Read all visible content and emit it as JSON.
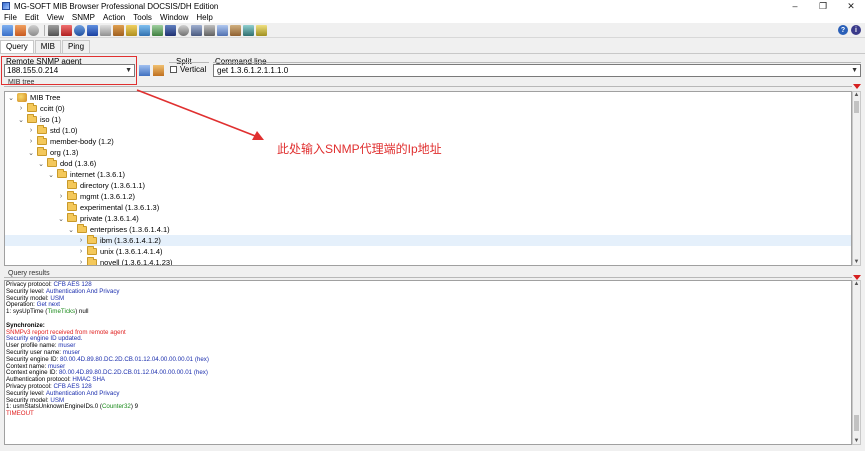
{
  "window": {
    "title": "MG-SOFT MIB Browser Professional DOCSIS/DH Edition"
  },
  "menu": [
    "File",
    "Edit",
    "View",
    "SNMP",
    "Action",
    "Tools",
    "Window",
    "Help"
  ],
  "tabs": [
    "Query",
    "MIB",
    "Ping"
  ],
  "query": {
    "agent_label": "Remote SNMP agent",
    "agent_value": "188.155.0.214",
    "split_label": "Split",
    "vertical_label": "Vertical",
    "command_label": "Command line",
    "command_value": "get 1.3.6.1.2.1.1.1.0"
  },
  "mib_tree": {
    "label": "MIB tree",
    "items": [
      {
        "label": "MIB Tree",
        "twisty": "⌄"
      },
      {
        "label": "ccitt (0)",
        "twisty": "›"
      },
      {
        "label": "iso (1)",
        "twisty": "⌄"
      },
      {
        "label": "std (1.0)",
        "twisty": "›"
      },
      {
        "label": "member-body (1.2)",
        "twisty": "›"
      },
      {
        "label": "org (1.3)",
        "twisty": "⌄"
      },
      {
        "label": "dod (1.3.6)",
        "twisty": "⌄"
      },
      {
        "label": "internet (1.3.6.1)",
        "twisty": "⌄"
      },
      {
        "label": "directory (1.3.6.1.1)",
        "twisty": ""
      },
      {
        "label": "mgmt (1.3.6.1.2)",
        "twisty": "›"
      },
      {
        "label": "experimental (1.3.6.1.3)",
        "twisty": ""
      },
      {
        "label": "private (1.3.6.1.4)",
        "twisty": "⌄"
      },
      {
        "label": "enterprises (1.3.6.1.4.1)",
        "twisty": "⌄"
      },
      {
        "label": "ibm (1.3.6.1.4.1.2)",
        "twisty": "›"
      },
      {
        "label": "unix (1.3.6.1.4.1.4)",
        "twisty": "›"
      },
      {
        "label": "novell (1.3.6.1.4.1.23)",
        "twisty": "›"
      }
    ]
  },
  "annotation": {
    "text": "此处输入SNMP代理端的Ip地址",
    "color": "#e03030"
  },
  "results": {
    "label": "Query results",
    "lines": [
      {
        "k": "Privacy protocol: ",
        "v": "CFB AES 128"
      },
      {
        "k": "Security level: ",
        "v": "Authentication And Privacy"
      },
      {
        "k": "Security model: ",
        "v": "USM"
      },
      {
        "k": "Operation: ",
        "v": "Get next"
      },
      {
        "k": "1: sysUpTime (",
        "g": "TimeTicks",
        "k2": ") null"
      },
      {
        "gap": true
      },
      {
        "k": "Synchronize:",
        "bold": true
      },
      {
        "k": "SNMPv3 report received from remote agent",
        "red": true
      },
      {
        "k": "Security engine ID updated.",
        "blue": true
      },
      {
        "k": "User profile name: ",
        "v": "muser"
      },
      {
        "k": "Security user name: ",
        "v": "muser"
      },
      {
        "k": "Security engine ID: ",
        "v": "80.00.4D.89.80.DC.2D.CB.01.12.04.00.00.00.01 (hex)"
      },
      {
        "k": "Context name: ",
        "v": "muser"
      },
      {
        "k": "Context engine ID: ",
        "v": "80.00.4D.89.80.DC.2D.CB.01.12.04.00.00.00.01 (hex)"
      },
      {
        "k": "Authentication protocol: ",
        "v": "HMAC SHA"
      },
      {
        "k": "Privacy protocol: ",
        "v": "CFB AES 128"
      },
      {
        "k": "Security level: ",
        "v": "Authentication And Privacy"
      },
      {
        "k": "Security model: ",
        "v": "USM"
      },
      {
        "k": "1: usmStatsUnknownEngineIDs.0 (",
        "g": "Counter32",
        "k2": ") 9"
      },
      {
        "k": "TIMEOUT",
        "red": true
      }
    ]
  },
  "colors": {
    "highlight": "#e03030",
    "value_blue": "#1c2fae",
    "type_green": "#1a8a1a"
  }
}
